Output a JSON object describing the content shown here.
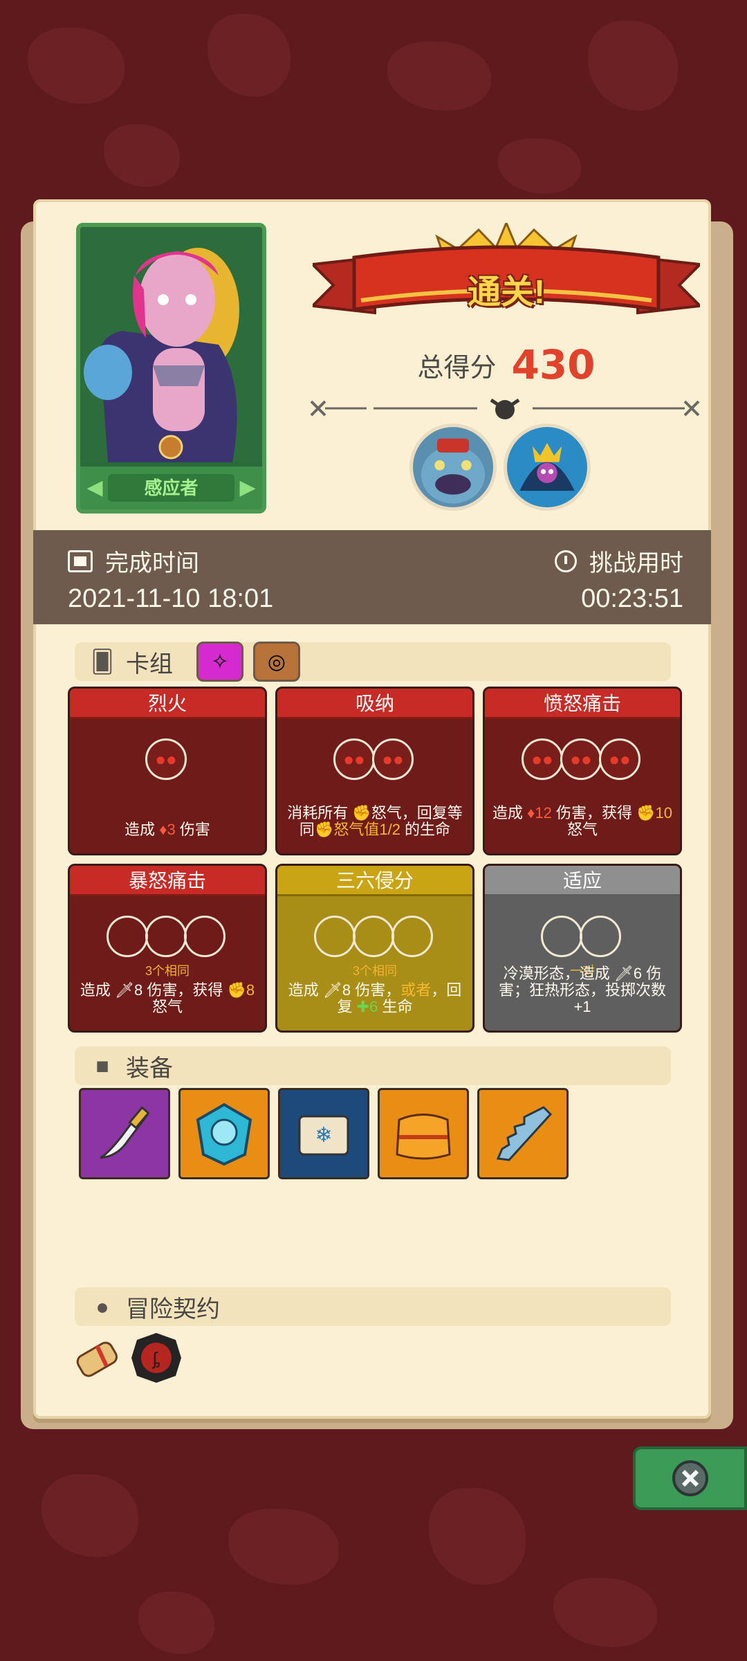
{
  "result": {
    "banner": "通关!",
    "score_label": "总得分",
    "score_value": "430"
  },
  "hero": {
    "name": "感应者"
  },
  "times": {
    "completion_label": "完成时间",
    "completion_value": "2021-11-10  18:01",
    "challenge_label": "挑战用时",
    "challenge_value": "00:23:51"
  },
  "deck": {
    "title": "卡组",
    "cards": [
      {
        "name": "烈火",
        "color": "red",
        "slots": 1,
        "note": "",
        "desc_parts": [
          "造成 ",
          "3",
          " 伤害"
        ]
      },
      {
        "name": "吸纳",
        "color": "red",
        "slots": 2,
        "note": "",
        "desc_parts": [
          "消耗所有 ",
          "怒气",
          "，回复等同",
          "怒气值1/2",
          " 的生命"
        ]
      },
      {
        "name": "愤怒痛击",
        "color": "red",
        "slots": 3,
        "note": "",
        "desc_parts": [
          "造成 ",
          "12",
          " 伤害，获得 ",
          "10",
          " 怒气"
        ]
      },
      {
        "name": "暴怒痛击",
        "color": "red",
        "slots": 3,
        "note": "3个相同",
        "desc_parts": [
          "造成 ",
          "8",
          " 伤害，获得 ",
          "8",
          " 怒气"
        ]
      },
      {
        "name": "三六侵分",
        "color": "gold",
        "slots": 3,
        "note": "3个相同",
        "desc_parts": [
          "造成 ",
          "8",
          " 伤害，",
          "或者",
          "，回复 ",
          "6",
          " 生命"
        ]
      },
      {
        "name": "适应",
        "color": "gray",
        "slots": 2,
        "note": "一对",
        "desc_parts": [
          "冷漠形态，造成 ",
          "6",
          " 伤害；狂热形态，投掷次数+1"
        ]
      }
    ]
  },
  "equipment": {
    "title": "装备",
    "items": [
      "dagger-icon",
      "crystal-shield-icon",
      "snowflake-scroll-icon",
      "sweater-icon",
      "sawtooth-blade-icon"
    ],
    "colors": [
      "#8e35a6",
      "#e98d13",
      "#1d4a7a",
      "#e98d13",
      "#e98d13"
    ]
  },
  "contract": {
    "title": "冒险契约"
  }
}
